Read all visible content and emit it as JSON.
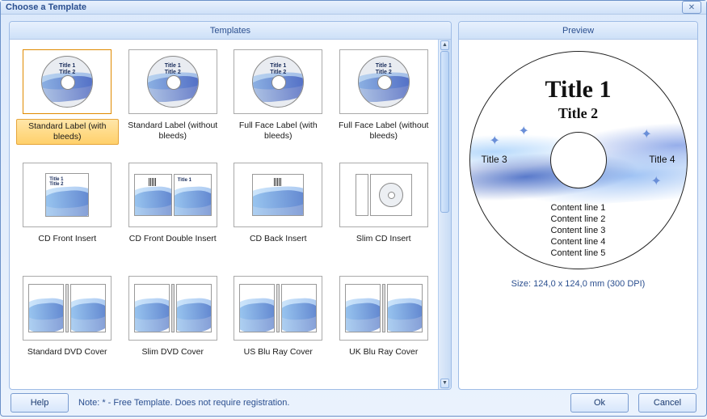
{
  "dialog": {
    "title": "Choose a Template"
  },
  "panels": {
    "templates": "Templates",
    "preview": "Preview"
  },
  "templates": [
    {
      "label": "Standard Label (with bleeds)",
      "kind": "disc",
      "selected": true
    },
    {
      "label": "Standard Label (without bleeds)",
      "kind": "disc"
    },
    {
      "label": "Full Face Label (with bleeds)",
      "kind": "disc"
    },
    {
      "label": "Full Face Label (without bleeds)",
      "kind": "disc"
    },
    {
      "label": "CD Front Insert",
      "kind": "single"
    },
    {
      "label": "CD Front Double Insert",
      "kind": "double"
    },
    {
      "label": "CD Back Insert",
      "kind": "back"
    },
    {
      "label": "Slim CD Insert",
      "kind": "slim"
    },
    {
      "label": "Standard DVD Cover",
      "kind": "dvd"
    },
    {
      "label": "Slim DVD Cover",
      "kind": "dvd"
    },
    {
      "label": "US Blu Ray Cover",
      "kind": "dvd"
    },
    {
      "label": "UK Blu Ray Cover",
      "kind": "dvd"
    }
  ],
  "thumb_text": {
    "title1": "Title 1",
    "title2": "Title 2"
  },
  "preview": {
    "title1": "Title 1",
    "title2": "Title 2",
    "title3": "Title 3",
    "title4": "Title 4",
    "content": [
      "Content line 1",
      "Content line 2",
      "Content line 3",
      "Content line 4",
      "Content line 5"
    ],
    "size_info": "Size: 124,0 x 124,0 mm (300 DPI)"
  },
  "footer": {
    "help": "Help",
    "note": "Note: * - Free Template. Does not require registration.",
    "ok": "Ok",
    "cancel": "Cancel"
  }
}
